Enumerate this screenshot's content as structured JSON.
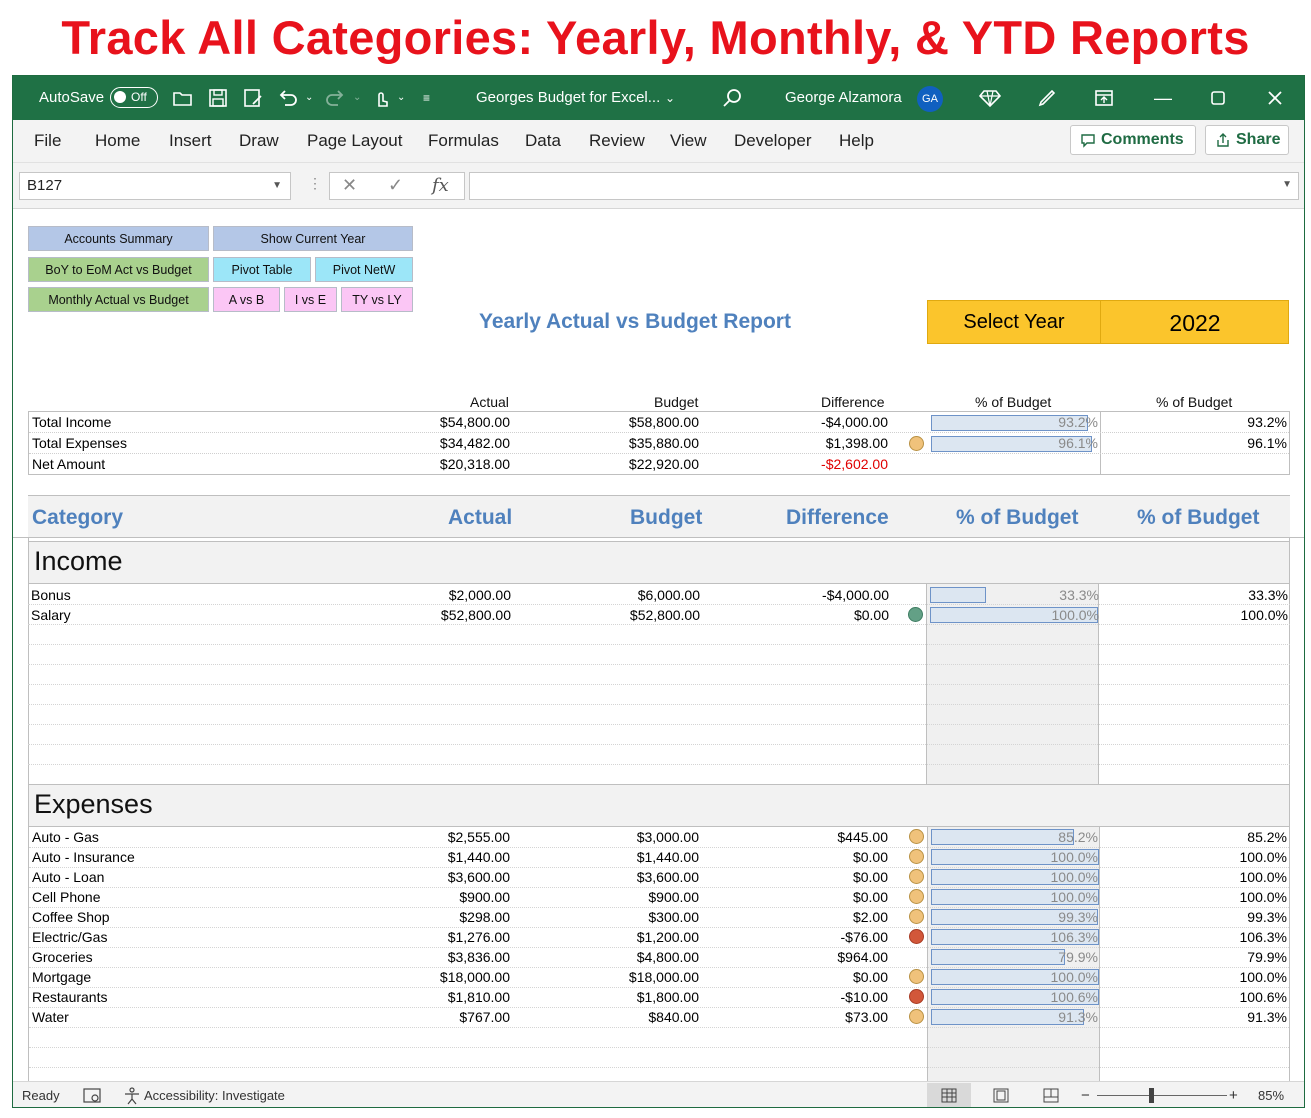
{
  "banner": "Track All Categories: Yearly, Monthly, & YTD Reports",
  "titlebar": {
    "autosave_label": "AutoSave",
    "autosave_state": "Off",
    "file_name": "Georges Budget for Excel...",
    "user_name": "George Alzamora",
    "user_initials": "GA"
  },
  "menu": [
    "File",
    "Home",
    "Insert",
    "Draw",
    "Page Layout",
    "Formulas",
    "Data",
    "Review",
    "View",
    "Developer",
    "Help"
  ],
  "ribbon_buttons": {
    "comments": "Comments",
    "share": "Share"
  },
  "formula_bar": {
    "name_box": "B127",
    "fx": "fx",
    "formula": ""
  },
  "nav_buttons": [
    "Accounts Summary",
    "Show Current Year",
    "BoY to EoM Act vs Budget",
    "Pivot Table",
    "Pivot NetW",
    "Monthly Actual vs Budget",
    "A vs B",
    "I vs E",
    "TY vs LY"
  ],
  "report_title": "Yearly Actual vs Budget Report",
  "select_year": {
    "label": "Select Year",
    "value": "2022"
  },
  "summary": {
    "headers": {
      "actual": "Actual",
      "budget": "Budget",
      "difference": "Difference",
      "pct_bar": "% of Budget",
      "pct": "% of Budget"
    },
    "rows": [
      {
        "name": "Total Income",
        "actual": "$54,800.00",
        "budget": "$58,800.00",
        "difference": "-$4,000.00",
        "pct_label": "93.2%",
        "pct": "93.2%",
        "fraction": 0.932,
        "status": ""
      },
      {
        "name": "Total Expenses",
        "actual": "$34,482.00",
        "budget": "$35,880.00",
        "difference": "$1,398.00",
        "pct_label": "96.1%",
        "pct": "96.1%",
        "fraction": 0.961,
        "status": "yellow"
      },
      {
        "name": "Net Amount",
        "actual": "$20,318.00",
        "budget": "$22,920.00",
        "difference": "-$2,602.00",
        "pct_label": "",
        "pct": "",
        "fraction": 0,
        "status": "",
        "difference_negative": true
      }
    ]
  },
  "category_header": {
    "category": "Category",
    "actual": "Actual",
    "budget": "Budget",
    "difference": "Difference",
    "pct_bar": "% of Budget",
    "pct": "% of Budget"
  },
  "income": {
    "title": "Income",
    "rows": [
      {
        "name": "Bonus",
        "actual": "$2,000.00",
        "budget": "$6,000.00",
        "difference": "-$4,000.00",
        "pct_label": "33.3%",
        "pct": "33.3%",
        "fraction": 0.333,
        "status": ""
      },
      {
        "name": "Salary",
        "actual": "$52,800.00",
        "budget": "$52,800.00",
        "difference": "$0.00",
        "pct_label": "100.0%",
        "pct": "100.0%",
        "fraction": 1.0,
        "status": "green"
      }
    ]
  },
  "expenses": {
    "title": "Expenses",
    "rows": [
      {
        "name": "Auto - Gas",
        "actual": "$2,555.00",
        "budget": "$3,000.00",
        "difference": "$445.00",
        "pct_label": "85.2%",
        "pct": "85.2%",
        "fraction": 0.852,
        "status": "yellow"
      },
      {
        "name": "Auto - Insurance",
        "actual": "$1,440.00",
        "budget": "$1,440.00",
        "difference": "$0.00",
        "pct_label": "100.0%",
        "pct": "100.0%",
        "fraction": 1.0,
        "status": "yellow"
      },
      {
        "name": "Auto - Loan",
        "actual": "$3,600.00",
        "budget": "$3,600.00",
        "difference": "$0.00",
        "pct_label": "100.0%",
        "pct": "100.0%",
        "fraction": 1.0,
        "status": "yellow"
      },
      {
        "name": "Cell Phone",
        "actual": "$900.00",
        "budget": "$900.00",
        "difference": "$0.00",
        "pct_label": "100.0%",
        "pct": "100.0%",
        "fraction": 1.0,
        "status": "yellow"
      },
      {
        "name": "Coffee Shop",
        "actual": "$298.00",
        "budget": "$300.00",
        "difference": "$2.00",
        "pct_label": "99.3%",
        "pct": "99.3%",
        "fraction": 0.993,
        "status": "yellow"
      },
      {
        "name": "Electric/Gas",
        "actual": "$1,276.00",
        "budget": "$1,200.00",
        "difference": "-$76.00",
        "pct_label": "106.3%",
        "pct": "106.3%",
        "fraction": 1.063,
        "status": "red"
      },
      {
        "name": "Groceries",
        "actual": "$3,836.00",
        "budget": "$4,800.00",
        "difference": "$964.00",
        "pct_label": "79.9%",
        "pct": "79.9%",
        "fraction": 0.799,
        "status": ""
      },
      {
        "name": "Mortgage",
        "actual": "$18,000.00",
        "budget": "$18,000.00",
        "difference": "$0.00",
        "pct_label": "100.0%",
        "pct": "100.0%",
        "fraction": 1.0,
        "status": "yellow"
      },
      {
        "name": "Restaurants",
        "actual": "$1,810.00",
        "budget": "$1,800.00",
        "difference": "-$10.00",
        "pct_label": "100.6%",
        "pct": "100.6%",
        "fraction": 1.006,
        "status": "red"
      },
      {
        "name": "Water",
        "actual": "$767.00",
        "budget": "$840.00",
        "difference": "$73.00",
        "pct_label": "91.3%",
        "pct": "91.3%",
        "fraction": 0.913,
        "status": "yellow"
      }
    ]
  },
  "status_bar": {
    "ready": "Ready",
    "accessibility": "Accessibility: Investigate",
    "zoom": "85%",
    "minus": "−",
    "plus": "+"
  },
  "colors": {
    "title_bar": "#1f7145",
    "header_blue": "#4f81bd",
    "select_year": "#fbc52c",
    "negative": "#e00000"
  }
}
